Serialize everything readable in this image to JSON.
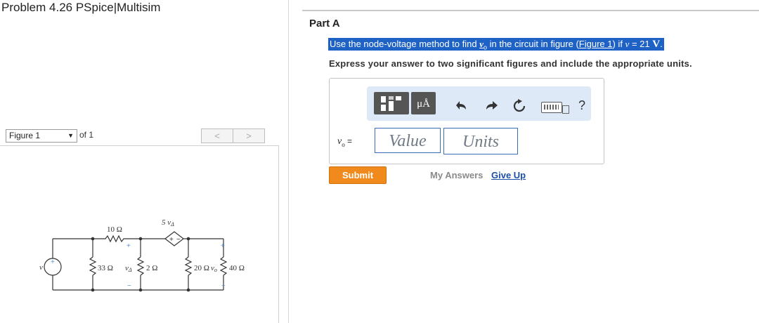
{
  "problem_title": "Problem 4.26 PSpice|Multisim",
  "figure_nav": {
    "selected": "Figure 1",
    "of_label": "of 1",
    "prev": "<",
    "next": ">"
  },
  "circuit": {
    "source_label": "v",
    "r10": "10 Ω",
    "r33": "33 Ω",
    "r2": "2 Ω",
    "r20": "20 Ω",
    "r40": "40 Ω",
    "dep_source": "5 v",
    "dep_sub": "Δ",
    "v_delta": "v",
    "v_delta_sub": "Δ",
    "v_o": "v",
    "v_o_sub": "o"
  },
  "part": {
    "title": "Part A",
    "question_pre": "Use the node-voltage method to find ",
    "question_var": "v",
    "question_var_sub": "o",
    "question_mid": " in the circuit in figure (",
    "question_link": "Figure 1",
    "question_post": ") if ",
    "question_v": "v",
    "question_eq": " = 21 ",
    "question_unit": "V",
    "question_end": ".",
    "instruction": "Express your answer to two significant figures and include the appropriate units."
  },
  "toolbar": {
    "units_glyph": "μÅ",
    "undo_icon": "undo-icon",
    "redo_icon": "redo-icon",
    "reset_icon": "reset-icon",
    "keyboard_icon": "keyboard-icon",
    "help": "?"
  },
  "answer": {
    "var_label": "v",
    "var_sub": "o",
    "equals": " =",
    "value_placeholder": "Value",
    "units_placeholder": "Units"
  },
  "actions": {
    "submit": "Submit",
    "my_answers": "My Answers",
    "give_up": "Give Up"
  },
  "colors": {
    "highlight": "#1f62c6",
    "submit": "#f08a1c",
    "toolbar_bg": "#dde9f7",
    "link": "#1c4fa6"
  }
}
